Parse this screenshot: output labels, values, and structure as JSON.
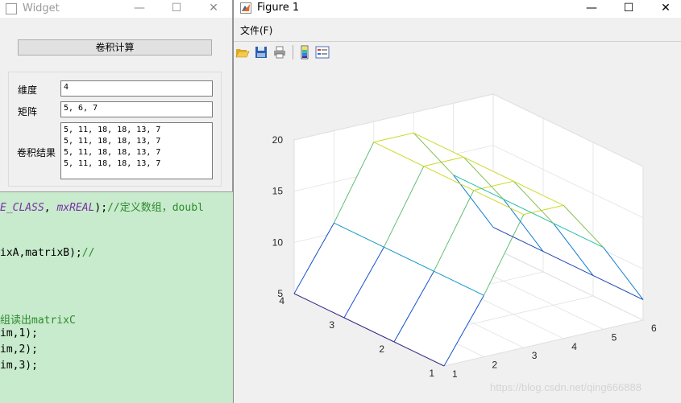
{
  "code": {
    "line1_a": "E_CLASS",
    "line1_b": ", ",
    "line1_c": "mxREAL",
    "line1_d": ");",
    "line1_e": "//定义数组，doubl",
    "line2": "ixA,matrixB);",
    "line2_comment": "//",
    "line3_comment": "组读出matrixC",
    "line4": "im,1);",
    "line5": "im,2);",
    "line6": "im,3);"
  },
  "widget": {
    "title": "Widget",
    "minimize": "—",
    "maximize": "☐",
    "close": "✕",
    "calc_button": "卷积计算",
    "dim_label": "维度",
    "dim_value": "4",
    "matrix_label": "矩阵",
    "matrix_value": "5, 6, 7",
    "result_label": "卷积结果",
    "result_lines": [
      "5, 11, 18, 18, 13, 7",
      "5, 11, 18, 18, 13, 7",
      "5, 11, 18, 18, 13, 7",
      "5, 11, 18, 18, 13, 7"
    ]
  },
  "figure": {
    "title": "Figure 1",
    "minimize": "—",
    "maximize": "☐",
    "close": "✕",
    "menu_file": "文件(F)",
    "toolbar_icons": [
      "open-folder-icon",
      "save-icon",
      "print-icon",
      "colorbar-icon",
      "legend-icon"
    ],
    "watermark": "https://blog.csdn.net/qing666888"
  },
  "chart_data": {
    "type": "surface",
    "x": [
      1,
      2,
      3,
      4,
      5,
      6
    ],
    "y": [
      1,
      2,
      3,
      4
    ],
    "z": [
      [
        5,
        11,
        18,
        18,
        13,
        7
      ],
      [
        5,
        11,
        18,
        18,
        13,
        7
      ],
      [
        5,
        11,
        18,
        18,
        13,
        7
      ],
      [
        5,
        11,
        18,
        18,
        13,
        7
      ]
    ],
    "x_ticks": [
      "1",
      "2",
      "3",
      "4",
      "5",
      "6"
    ],
    "y_ticks": [
      "1",
      "2",
      "3",
      "4"
    ],
    "z_ticks": [
      "5",
      "10",
      "15",
      "20"
    ],
    "xlim": [
      1,
      6
    ],
    "ylim": [
      1,
      4
    ],
    "zlim": [
      5,
      20
    ],
    "colormap": "parula",
    "grid": true
  }
}
